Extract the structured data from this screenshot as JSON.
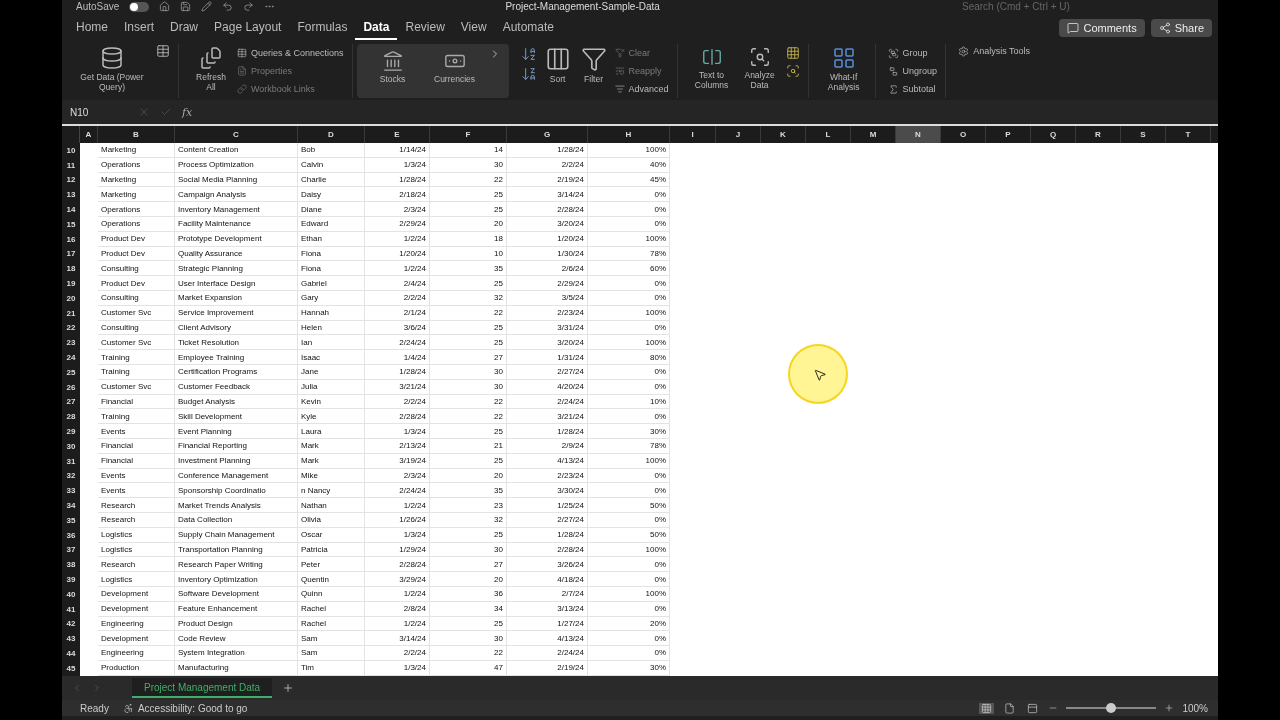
{
  "title_bar": {
    "autosave_label": "AutoSave",
    "autosave_on": false,
    "document_title": "Project-Management-Sample-Data",
    "search": {
      "placeholder": "Search (Cmd + Ctrl + U)"
    }
  },
  "menu_tabs": [
    {
      "label": "Home",
      "selected": false
    },
    {
      "label": "Insert",
      "selected": false
    },
    {
      "label": "Draw",
      "selected": false
    },
    {
      "label": "Page Layout",
      "selected": false
    },
    {
      "label": "Formulas",
      "selected": false
    },
    {
      "label": "Data",
      "selected": true
    },
    {
      "label": "Review",
      "selected": false
    },
    {
      "label": "View",
      "selected": false
    },
    {
      "label": "Automate",
      "selected": false
    }
  ],
  "header_buttons": [
    "Comments",
    "Share"
  ],
  "ribbon": {
    "get_data": "Get Data (Power Query)",
    "refresh": "Refresh All",
    "queries": [
      {
        "label": "Queries & Connections",
        "disabled": false
      },
      {
        "label": "Properties",
        "disabled": true
      },
      {
        "label": "Workbook Links",
        "disabled": true
      }
    ],
    "data_types": [
      "Stocks",
      "Currencies"
    ],
    "sort": "Sort",
    "filter": "Filter",
    "filter_options": [
      {
        "label": "Clear",
        "disabled": true
      },
      {
        "label": "Reapply",
        "disabled": true
      },
      {
        "label": "Advanced",
        "disabled": false
      }
    ],
    "text_to_columns": "Text to Columns",
    "analyze_data": "Analyze Data",
    "what_if": "What-If Analysis",
    "outline": [
      "Group",
      "Ungroup",
      "Subtotal"
    ],
    "analysis_tools": "Analysis Tools"
  },
  "formula_bar": {
    "name_box": "N10",
    "function_label": "fx"
  },
  "sheet": {
    "columns": [
      {
        "label": "A",
        "selected": false
      },
      {
        "label": "B",
        "selected": false
      },
      {
        "label": "C",
        "selected": false
      },
      {
        "label": "D",
        "selected": false
      },
      {
        "label": "E",
        "selected": false
      },
      {
        "label": "F",
        "selected": false
      },
      {
        "label": "G",
        "selected": false
      },
      {
        "label": "H",
        "selected": false
      },
      {
        "label": "I",
        "selected": false
      },
      {
        "label": "J",
        "selected": false
      },
      {
        "label": "K",
        "selected": false
      },
      {
        "label": "L",
        "selected": false
      },
      {
        "label": "M",
        "selected": false
      },
      {
        "label": "N",
        "selected": true
      },
      {
        "label": "O",
        "selected": false
      },
      {
        "label": "P",
        "selected": false
      },
      {
        "label": "Q",
        "selected": false
      },
      {
        "label": "R",
        "selected": false
      },
      {
        "label": "S",
        "selected": false
      },
      {
        "label": "T",
        "selected": false
      }
    ],
    "rows": [
      {
        "number": "10",
        "cells": [
          "",
          "Marketing",
          "Content Creation",
          "Bob",
          "1/14/24",
          "14",
          "1/28/24",
          "100%"
        ]
      },
      {
        "number": "11",
        "cells": [
          "",
          "Operations",
          "Process Optimization",
          "Calvin",
          "1/3/24",
          "30",
          "2/2/24",
          "40%"
        ]
      },
      {
        "number": "12",
        "cells": [
          "",
          "Marketing",
          "Social Media Planning",
          "Charlie",
          "1/28/24",
          "22",
          "2/19/24",
          "45%"
        ]
      },
      {
        "number": "13",
        "cells": [
          "",
          "Marketing",
          "Campaign Analysis",
          "Daisy",
          "2/18/24",
          "25",
          "3/14/24",
          "0%"
        ]
      },
      {
        "number": "14",
        "cells": [
          "",
          "Operations",
          "Inventory Management",
          "Diane",
          "2/3/24",
          "25",
          "2/28/24",
          "0%"
        ]
      },
      {
        "number": "15",
        "cells": [
          "",
          "Operations",
          "Facility Maintenance",
          "Edward",
          "2/29/24",
          "20",
          "3/20/24",
          "0%"
        ]
      },
      {
        "number": "16",
        "cells": [
          "",
          "Product Dev",
          "Prototype Development",
          "Ethan",
          "1/2/24",
          "18",
          "1/20/24",
          "100%"
        ]
      },
      {
        "number": "17",
        "cells": [
          "",
          "Product Dev",
          "Quality Assurance",
          "Fiona",
          "1/20/24",
          "10",
          "1/30/24",
          "78%"
        ]
      },
      {
        "number": "18",
        "cells": [
          "",
          "Consulting",
          "Strategic Planning",
          "Fiona",
          "1/2/24",
          "35",
          "2/6/24",
          "60%"
        ]
      },
      {
        "number": "19",
        "cells": [
          "",
          "Product Dev",
          "User Interface Design",
          "Gabriel",
          "2/4/24",
          "25",
          "2/29/24",
          "0%"
        ]
      },
      {
        "number": "20",
        "cells": [
          "",
          "Consulting",
          "Market Expansion",
          "Gary",
          "2/2/24",
          "32",
          "3/5/24",
          "0%"
        ]
      },
      {
        "number": "21",
        "cells": [
          "",
          "Customer Svc",
          "Service Improvement",
          "Hannah",
          "2/1/24",
          "22",
          "2/23/24",
          "100%"
        ]
      },
      {
        "number": "22",
        "cells": [
          "",
          "Consulting",
          "Client Advisory",
          "Helen",
          "3/6/24",
          "25",
          "3/31/24",
          "0%"
        ]
      },
      {
        "number": "23",
        "cells": [
          "",
          "Customer Svc",
          "Ticket Resolution",
          "Ian",
          "2/24/24",
          "25",
          "3/20/24",
          "100%"
        ]
      },
      {
        "number": "24",
        "cells": [
          "",
          "Training",
          "Employee Training",
          "Isaac",
          "1/4/24",
          "27",
          "1/31/24",
          "80%"
        ]
      },
      {
        "number": "25",
        "cells": [
          "",
          "Training",
          "Certification Programs",
          "Jane",
          "1/28/24",
          "30",
          "2/27/24",
          "0%"
        ]
      },
      {
        "number": "26",
        "cells": [
          "",
          "Customer Svc",
          "Customer Feedback",
          "Julia",
          "3/21/24",
          "30",
          "4/20/24",
          "0%"
        ]
      },
      {
        "number": "27",
        "cells": [
          "",
          "Financial",
          "Budget Analysis",
          "Kevin",
          "2/2/24",
          "22",
          "2/24/24",
          "10%"
        ]
      },
      {
        "number": "28",
        "cells": [
          "",
          "Training",
          "Skill Development",
          "Kyle",
          "2/28/24",
          "22",
          "3/21/24",
          "0%"
        ]
      },
      {
        "number": "29",
        "cells": [
          "",
          "Events",
          "Event Planning",
          "Laura",
          "1/3/24",
          "25",
          "1/28/24",
          "30%"
        ]
      },
      {
        "number": "30",
        "cells": [
          "",
          "Financial",
          "Financial Reporting",
          "Mark",
          "2/13/24",
          "21",
          "2/9/24",
          "78%"
        ]
      },
      {
        "number": "31",
        "cells": [
          "",
          "Financial",
          "Investment Planning",
          "Mark",
          "3/19/24",
          "25",
          "4/13/24",
          "100%"
        ]
      },
      {
        "number": "32",
        "cells": [
          "",
          "Events",
          "Conference Management",
          "Mike",
          "2/3/24",
          "20",
          "2/23/24",
          "0%"
        ]
      },
      {
        "number": "33",
        "cells": [
          "",
          "Events",
          "Sponsorship Coordinatio",
          "n Nancy",
          "2/24/24",
          "35",
          "3/30/24",
          "0%"
        ]
      },
      {
        "number": "34",
        "cells": [
          "",
          "Research",
          "Market Trends Analysis",
          "Nathan",
          "1/2/24",
          "23",
          "1/25/24",
          "50%"
        ]
      },
      {
        "number": "35",
        "cells": [
          "",
          "Research",
          "Data Collection",
          "Olivia",
          "1/26/24",
          "32",
          "2/27/24",
          "0%"
        ]
      },
      {
        "number": "36",
        "cells": [
          "",
          "Logistics",
          "Supply Chain Management",
          "Oscar",
          "1/3/24",
          "25",
          "1/28/24",
          "50%"
        ]
      },
      {
        "number": "37",
        "cells": [
          "",
          "Logistics",
          "Transportation Planning",
          "Patricia",
          "1/29/24",
          "30",
          "2/28/24",
          "100%"
        ]
      },
      {
        "number": "38",
        "cells": [
          "",
          "Research",
          "Research Paper Writing",
          "Peter",
          "2/28/24",
          "27",
          "3/26/24",
          "0%"
        ]
      },
      {
        "number": "39",
        "cells": [
          "",
          "Logistics",
          "Inventory Optimization",
          "Quentin",
          "3/29/24",
          "20",
          "4/18/24",
          "0%"
        ]
      },
      {
        "number": "40",
        "cells": [
          "",
          "Development",
          "Software Development",
          "Quinn",
          "1/2/24",
          "36",
          "2/7/24",
          "100%"
        ]
      },
      {
        "number": "41",
        "cells": [
          "",
          "Development",
          "Feature Enhancement",
          "Rachel",
          "2/8/24",
          "34",
          "3/13/24",
          "0%"
        ]
      },
      {
        "number": "42",
        "cells": [
          "",
          "Engineering",
          "Product Design",
          "Rachel",
          "1/2/24",
          "25",
          "1/27/24",
          "20%"
        ]
      },
      {
        "number": "43",
        "cells": [
          "",
          "Development",
          "Code Review",
          "Sam",
          "3/14/24",
          "30",
          "4/13/24",
          "0%"
        ]
      },
      {
        "number": "44",
        "cells": [
          "",
          "Engineering",
          "System Integration",
          "Sam",
          "2/2/24",
          "22",
          "2/24/24",
          "0%"
        ]
      },
      {
        "number": "45",
        "cells": [
          "",
          "Production",
          "Manufacturing",
          "Tim",
          "1/3/24",
          "47",
          "2/19/24",
          "30%"
        ]
      }
    ]
  },
  "sheet_tabs": [
    {
      "label": "Project Management Data",
      "selected": true
    }
  ],
  "status_bar": {
    "ready": "Ready",
    "accessibility": "Accessibility: Good to go",
    "views": [
      {
        "selected": true
      },
      {
        "selected": false
      },
      {
        "selected": false
      }
    ],
    "zoom": {
      "level": 0.5,
      "reading": "100%"
    }
  }
}
